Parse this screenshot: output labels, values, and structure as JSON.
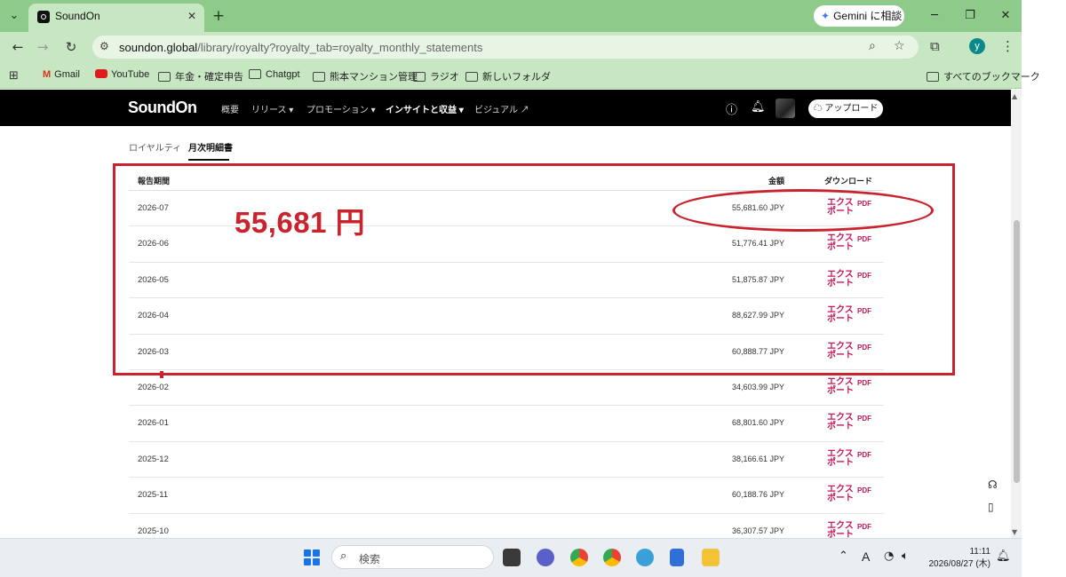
{
  "browser": {
    "tab_title": "SoundOn",
    "gemini_label": "Gemini に相談",
    "url_domain": "soundon.global",
    "url_path": "/library/royalty?royalty_tab=royalty_monthly_statements",
    "profile_initial": "y",
    "bookmarks": [
      "Gmail",
      "YouTube",
      "年金・確定申告",
      "Chatgpt",
      "熊本マンション管理",
      "ラジオ",
      "新しいフォルダ"
    ],
    "all_bookmarks": "すべてのブックマーク"
  },
  "site": {
    "logo": "SoundOn",
    "nav": {
      "overview": "概要",
      "release": "リリース ▾",
      "promotion": "プロモーション ▾",
      "insights": "インサイトと収益 ▾",
      "visual": "ビジュアル ↗"
    },
    "upload_label": "アップロード"
  },
  "subtabs": {
    "royalty": "ロイヤルティ",
    "monthly": "月次明細書"
  },
  "table": {
    "headers": {
      "period": "報告期間",
      "amount": "金額",
      "download": "ダウンロード"
    },
    "export_label": "エクスポート",
    "pdf_label": "PDF",
    "rows": [
      {
        "period": "2026-07",
        "amount": "55,681.60 JPY"
      },
      {
        "period": "2026-06",
        "amount": "51,776.41 JPY"
      },
      {
        "period": "2026-05",
        "amount": "51,875.87 JPY"
      },
      {
        "period": "2026-04",
        "amount": "88,627.99 JPY"
      },
      {
        "period": "2026-03",
        "amount": "60,888.77 JPY"
      },
      {
        "period": "2026-02",
        "amount": "34,603.99 JPY"
      },
      {
        "period": "2026-01",
        "amount": "68,801.60 JPY"
      },
      {
        "period": "2025-12",
        "amount": "38,166.61 JPY"
      },
      {
        "period": "2025-11",
        "amount": "60,188.76 JPY"
      },
      {
        "period": "2025-10",
        "amount": "36,307.57 JPY"
      }
    ]
  },
  "annotation": {
    "big_amount": "55,681 円",
    "color": "#c9232d"
  },
  "taskbar": {
    "search_placeholder": "検索",
    "time": "11:11",
    "date": "2026/08/27 (木)",
    "ime": "A"
  },
  "colors": {
    "chrome_green": "#8ecb8a",
    "site_header": "#000000",
    "export_link": "#c2185b"
  }
}
